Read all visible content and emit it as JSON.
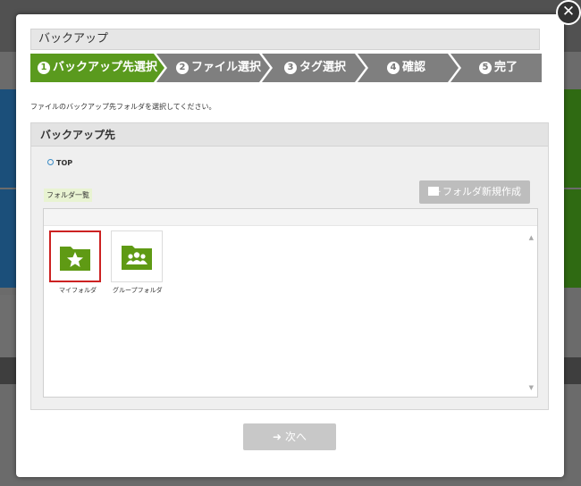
{
  "dialog": {
    "title": "バックアップ",
    "close_label": "✕",
    "instruction": "ファイルのバックアップ先フォルダを選択してください。"
  },
  "steps": [
    {
      "num": "1",
      "label": "バックアップ先選択",
      "active": true
    },
    {
      "num": "2",
      "label": "ファイル選択",
      "active": false
    },
    {
      "num": "3",
      "label": "タグ選択",
      "active": false
    },
    {
      "num": "4",
      "label": "確認",
      "active": false
    },
    {
      "num": "5",
      "label": "完了",
      "active": false
    }
  ],
  "panel": {
    "title": "バックアップ先",
    "crumb": "TOP",
    "folder_list_label": "フォルダ一覧",
    "new_folder_button": "フォルダ新規作成"
  },
  "folders": [
    {
      "label": "マイフォルダ",
      "icon": "star-folder-icon",
      "selected": true
    },
    {
      "label": "グループフォルダ",
      "icon": "group-folder-icon",
      "selected": false
    }
  ],
  "footer": {
    "next_button": "次へ"
  },
  "colors": {
    "active_step": "#5a9a1e",
    "inactive_step": "#7f7f7f",
    "folder_green": "#5f9a14",
    "selected_border": "#cc2222"
  }
}
